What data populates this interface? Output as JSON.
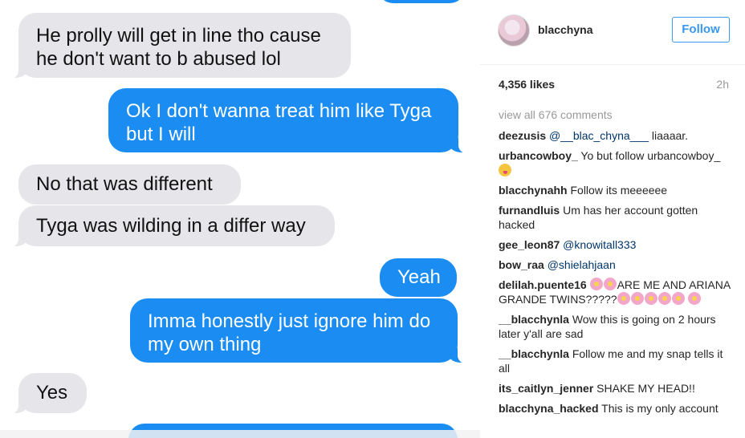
{
  "chat": {
    "messages": [
      {
        "side": "left",
        "text_line1": "He prolly will get in line tho cause",
        "text_line2": "he don't want to b abused lol"
      },
      {
        "side": "right",
        "text_line1": "Ok I don't wanna treat him like Tyga",
        "text_line2": "but I will"
      },
      {
        "side": "left",
        "text_line1": "No that was different"
      },
      {
        "side": "left",
        "text_line1": "Tyga was wilding in a differ way"
      },
      {
        "side": "right",
        "text_line1": "Yeah"
      },
      {
        "side": "right",
        "text_line1": "Imma honestly just ignore him do",
        "text_line2": "my own thing"
      },
      {
        "side": "left",
        "text_line1": "Yes"
      }
    ],
    "colors": {
      "gray": "#e5e5ea",
      "blue": "#1a8cf2"
    }
  },
  "post": {
    "username": "blacchyna",
    "follow_label": "Follow",
    "likes": "4,356 likes",
    "time": "2h",
    "view_all": "view all 676 comments",
    "comments": [
      {
        "user": "deezusis",
        "mention": "@__blac_chyna___",
        "text": " liaaaar."
      },
      {
        "user": "urbancowboy_",
        "text": " Yo but follow urbancowboy_ "
      },
      {
        "user": "blacchynahh",
        "text": " Follow its meeeeee"
      },
      {
        "user": "furnandluis",
        "text": " Um has her account gotten hacked"
      },
      {
        "user": "gee_leon87",
        "mention": "@knowitall333"
      },
      {
        "user": "bow_raa",
        "mention": "@shielahjaan"
      },
      {
        "user": "delilah.puente16",
        "text": "ARE ME AND ARIANA GRANDE TWINS?????"
      },
      {
        "user": "__blacchynla",
        "text": " Wow this is going on 2 hours later y'all are sad"
      },
      {
        "user": "__blacchynla",
        "text": " Follow me and my snap tells it all"
      },
      {
        "user": "its_caitlyn_jenner",
        "text": " SHAKE MY HEAD!!"
      },
      {
        "user": "blacchyna_hacked",
        "text": " This is my only account"
      }
    ],
    "accent": "#3897f0"
  }
}
